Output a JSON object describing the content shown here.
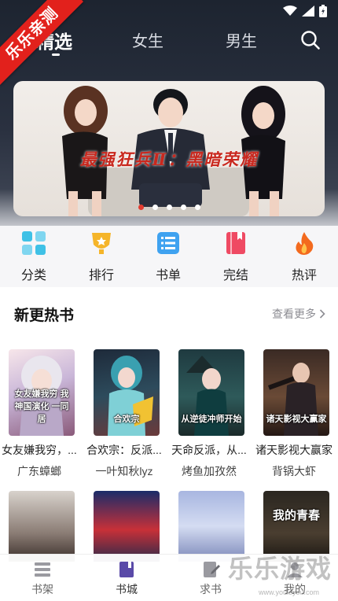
{
  "ribbon": {
    "text": "乐乐亲测"
  },
  "tabs": [
    {
      "label": "精选",
      "active": true
    },
    {
      "label": "女生",
      "active": false
    },
    {
      "label": "男生",
      "active": false
    }
  ],
  "banner": {
    "title": "最强狂兵Ⅱ：黑暗荣耀",
    "slide_count": 5,
    "active_slide": 1
  },
  "categories": [
    {
      "label": "分类",
      "icon": "grid-icon"
    },
    {
      "label": "排行",
      "icon": "trophy-icon"
    },
    {
      "label": "书单",
      "icon": "list-icon"
    },
    {
      "label": "完结",
      "icon": "book-icon"
    },
    {
      "label": "热评",
      "icon": "flame-icon"
    }
  ],
  "section": {
    "title": "新更热书",
    "more": "查看更多"
  },
  "books": [
    {
      "title": "女友嫌我穷，...",
      "author": "广东蟑螂",
      "cover_text": "女友嫌我穷 我神国演化 一同居"
    },
    {
      "title": "合欢宗：反派...",
      "author": "一叶知秋lyz",
      "cover_text": "合欢宗"
    },
    {
      "title": "天命反派，从...",
      "author": "烤鱼加孜然",
      "cover_text": "从逆徒冲师开始"
    },
    {
      "title": "诸天影视大赢家",
      "author": "背锅大虾",
      "cover_text": "诸天影视大赢家"
    }
  ],
  "books_row2": [
    {
      "cover_text": ""
    },
    {
      "cover_text": ""
    },
    {
      "cover_text": ""
    },
    {
      "cover_text": "我的青春"
    }
  ],
  "bottom_nav": [
    {
      "label": "书架",
      "icon": "bookshelf-icon"
    },
    {
      "label": "书城",
      "icon": "bookstore-icon",
      "active": true
    },
    {
      "label": "求书",
      "icon": "request-icon"
    },
    {
      "label": "我的",
      "icon": "profile-icon"
    }
  ],
  "watermark": {
    "text": "乐乐游戏",
    "sub": "www.youleyou.com"
  },
  "colors": {
    "accent": "#e23b2f",
    "ribbon": "#e2211c",
    "header_bg": "#1d2430"
  }
}
